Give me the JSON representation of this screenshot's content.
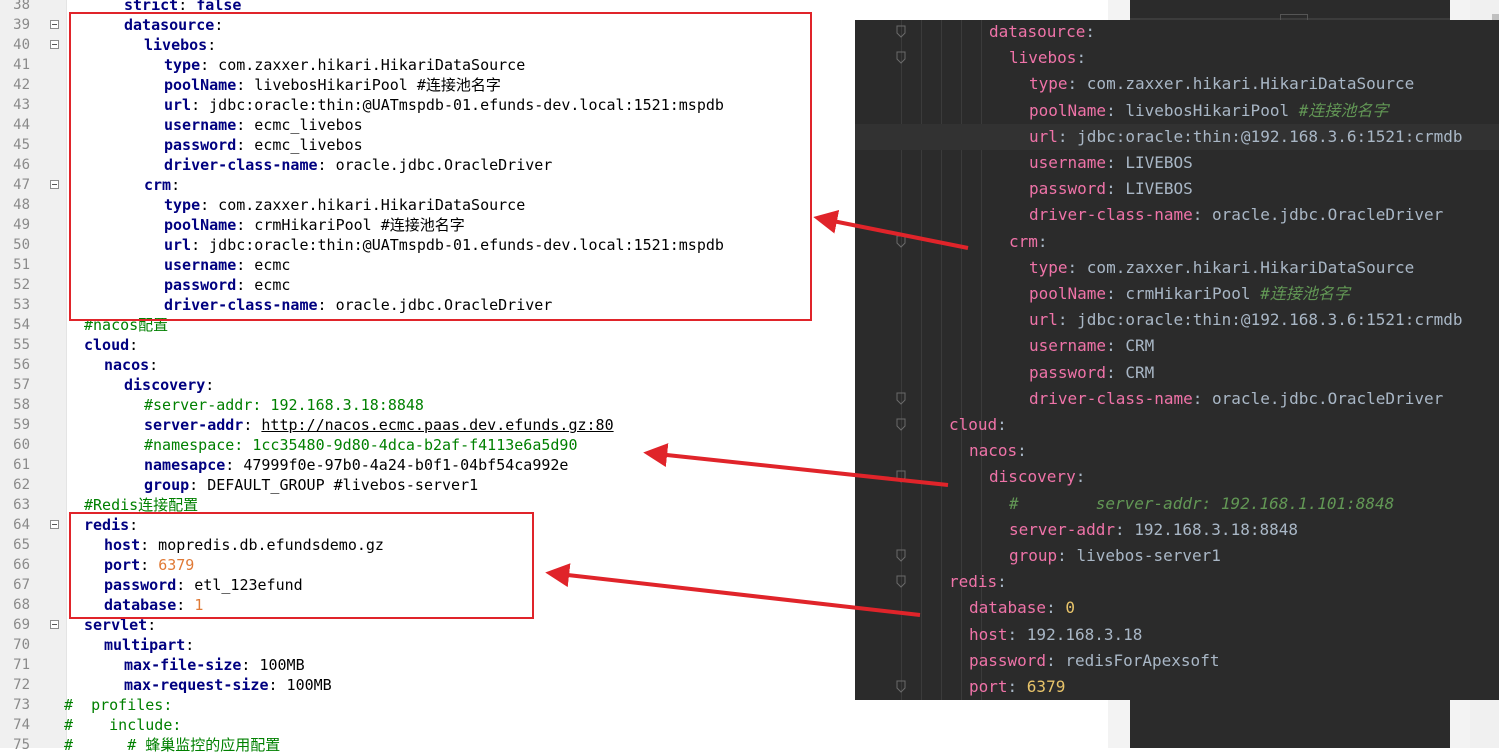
{
  "left_editor": {
    "lines": [
      {
        "num": "38",
        "fold": false,
        "indent": 6,
        "parts": [
          {
            "t": "strict",
            "c": "k"
          },
          {
            "t": ": ",
            "c": "v"
          },
          {
            "t": "false",
            "c": "k"
          }
        ]
      },
      {
        "num": "39",
        "fold": true,
        "indent": 6,
        "parts": [
          {
            "t": "datasource",
            "c": "k"
          },
          {
            "t": ":",
            "c": "v"
          }
        ]
      },
      {
        "num": "40",
        "fold": true,
        "indent": 8,
        "parts": [
          {
            "t": "livebos",
            "c": "k"
          },
          {
            "t": ":",
            "c": "v"
          }
        ]
      },
      {
        "num": "41",
        "fold": false,
        "indent": 10,
        "parts": [
          {
            "t": "type",
            "c": "k"
          },
          {
            "t": ": com.zaxxer.hikari.HikariDataSource",
            "c": "v"
          }
        ]
      },
      {
        "num": "42",
        "fold": false,
        "indent": 10,
        "parts": [
          {
            "t": "poolName",
            "c": "k"
          },
          {
            "t": ": livebosHikariPool #连接池名字",
            "c": "v"
          }
        ]
      },
      {
        "num": "43",
        "fold": false,
        "indent": 10,
        "parts": [
          {
            "t": "url",
            "c": "k"
          },
          {
            "t": ": jdbc:oracle:thin:@UATmspdb-01.efunds-dev.local:1521:mspdb",
            "c": "v"
          }
        ]
      },
      {
        "num": "44",
        "fold": false,
        "indent": 10,
        "parts": [
          {
            "t": "username",
            "c": "k"
          },
          {
            "t": ": ecmc_livebos",
            "c": "v"
          }
        ]
      },
      {
        "num": "45",
        "fold": false,
        "indent": 10,
        "parts": [
          {
            "t": "password",
            "c": "k"
          },
          {
            "t": ": ecmc_livebos",
            "c": "v"
          }
        ]
      },
      {
        "num": "46",
        "fold": false,
        "indent": 10,
        "parts": [
          {
            "t": "driver-class-name",
            "c": "k"
          },
          {
            "t": ": oracle.jdbc.OracleDriver",
            "c": "v"
          }
        ]
      },
      {
        "num": "47",
        "fold": true,
        "indent": 8,
        "parts": [
          {
            "t": "crm",
            "c": "k"
          },
          {
            "t": ":",
            "c": "v"
          }
        ]
      },
      {
        "num": "48",
        "fold": false,
        "indent": 10,
        "parts": [
          {
            "t": "type",
            "c": "k"
          },
          {
            "t": ": com.zaxxer.hikari.HikariDataSource",
            "c": "v"
          }
        ]
      },
      {
        "num": "49",
        "fold": false,
        "indent": 10,
        "parts": [
          {
            "t": "poolName",
            "c": "k"
          },
          {
            "t": ": crmHikariPool #连接池名字",
            "c": "v"
          }
        ]
      },
      {
        "num": "50",
        "fold": false,
        "indent": 10,
        "parts": [
          {
            "t": "url",
            "c": "k"
          },
          {
            "t": ": jdbc:oracle:thin:@UATmspdb-01.efunds-dev.local:1521:mspdb",
            "c": "v"
          }
        ]
      },
      {
        "num": "51",
        "fold": false,
        "indent": 10,
        "parts": [
          {
            "t": "username",
            "c": "k"
          },
          {
            "t": ": ecmc",
            "c": "v"
          }
        ]
      },
      {
        "num": "52",
        "fold": false,
        "indent": 10,
        "parts": [
          {
            "t": "password",
            "c": "k"
          },
          {
            "t": ": ecmc",
            "c": "v"
          }
        ]
      },
      {
        "num": "53",
        "fold": false,
        "indent": 10,
        "parts": [
          {
            "t": "driver-class-name",
            "c": "k"
          },
          {
            "t": ": oracle.jdbc.OracleDriver",
            "c": "v"
          }
        ]
      },
      {
        "num": "54",
        "fold": false,
        "indent": 2,
        "parts": [
          {
            "t": "#nacos配置",
            "c": "c"
          }
        ]
      },
      {
        "num": "55",
        "fold": false,
        "indent": 2,
        "parts": [
          {
            "t": "cloud",
            "c": "k"
          },
          {
            "t": ":",
            "c": "v"
          }
        ]
      },
      {
        "num": "56",
        "fold": false,
        "indent": 4,
        "parts": [
          {
            "t": "nacos",
            "c": "k"
          },
          {
            "t": ":",
            "c": "v"
          }
        ]
      },
      {
        "num": "57",
        "fold": false,
        "indent": 6,
        "parts": [
          {
            "t": "discovery",
            "c": "k"
          },
          {
            "t": ":",
            "c": "v"
          }
        ]
      },
      {
        "num": "58",
        "fold": false,
        "indent": 8,
        "parts": [
          {
            "t": "#server-addr: 192.168.3.18:8848",
            "c": "c"
          }
        ]
      },
      {
        "num": "59",
        "fold": false,
        "indent": 8,
        "parts": [
          {
            "t": "server-addr",
            "c": "k"
          },
          {
            "t": ": ",
            "c": "v"
          },
          {
            "t": "http://nacos.ecmc.paas.dev.efunds.gz:80",
            "c": "u"
          }
        ]
      },
      {
        "num": "60",
        "fold": false,
        "indent": 8,
        "parts": [
          {
            "t": "#namespace: 1cc35480-9d80-4dca-b2af-f4113e6a5d90",
            "c": "c"
          }
        ]
      },
      {
        "num": "61",
        "fold": false,
        "indent": 8,
        "parts": [
          {
            "t": "namesapce",
            "c": "k"
          },
          {
            "t": ": 47999f0e-97b0-4a24-b0f1-04bf54ca992e",
            "c": "v"
          }
        ]
      },
      {
        "num": "62",
        "fold": false,
        "indent": 8,
        "parts": [
          {
            "t": "group",
            "c": "k"
          },
          {
            "t": ": DEFAULT_GROUP #livebos-server1",
            "c": "v"
          }
        ]
      },
      {
        "num": "63",
        "fold": false,
        "indent": 2,
        "parts": [
          {
            "t": "#Redis连接配置",
            "c": "c"
          }
        ]
      },
      {
        "num": "64",
        "fold": true,
        "indent": 2,
        "parts": [
          {
            "t": "redis",
            "c": "k"
          },
          {
            "t": ":",
            "c": "v"
          }
        ]
      },
      {
        "num": "65",
        "fold": false,
        "indent": 4,
        "parts": [
          {
            "t": "host",
            "c": "k"
          },
          {
            "t": ": mopredis.db.efundsdemo.gz",
            "c": "v"
          }
        ]
      },
      {
        "num": "66",
        "fold": false,
        "indent": 4,
        "parts": [
          {
            "t": "port",
            "c": "k"
          },
          {
            "t": ": ",
            "c": "v"
          },
          {
            "t": "6379",
            "c": "n"
          }
        ]
      },
      {
        "num": "67",
        "fold": false,
        "indent": 4,
        "parts": [
          {
            "t": "password",
            "c": "k"
          },
          {
            "t": ": etl_123efund",
            "c": "v"
          }
        ]
      },
      {
        "num": "68",
        "fold": false,
        "indent": 4,
        "parts": [
          {
            "t": "database",
            "c": "k"
          },
          {
            "t": ": ",
            "c": "v"
          },
          {
            "t": "1",
            "c": "n"
          }
        ]
      },
      {
        "num": "69",
        "fold": true,
        "indent": 2,
        "parts": [
          {
            "t": "servlet",
            "c": "k"
          },
          {
            "t": ":",
            "c": "v"
          }
        ]
      },
      {
        "num": "70",
        "fold": false,
        "indent": 4,
        "parts": [
          {
            "t": "multipart",
            "c": "k"
          },
          {
            "t": ":",
            "c": "v"
          }
        ]
      },
      {
        "num": "71",
        "fold": false,
        "indent": 6,
        "parts": [
          {
            "t": "max-file-size",
            "c": "k"
          },
          {
            "t": ": 100MB",
            "c": "v"
          }
        ]
      },
      {
        "num": "72",
        "fold": false,
        "indent": 6,
        "parts": [
          {
            "t": "max-request-size",
            "c": "k"
          },
          {
            "t": ": 100MB",
            "c": "v"
          }
        ]
      },
      {
        "num": "73",
        "fold": false,
        "indent": 0,
        "parts": [
          {
            "t": "#  profiles:",
            "c": "c"
          }
        ]
      },
      {
        "num": "74",
        "fold": false,
        "indent": 0,
        "parts": [
          {
            "t": "#    include:",
            "c": "c"
          }
        ]
      },
      {
        "num": "75",
        "fold": false,
        "indent": 0,
        "parts": [
          {
            "t": "#      # 蜂巢监控的应用配置",
            "c": "c"
          }
        ]
      }
    ]
  },
  "right_editor": {
    "lines": [
      {
        "indent": 5,
        "parts": [
          {
            "t": "datasource",
            "c": "dk"
          },
          {
            "t": ":",
            "c": "dv"
          }
        ]
      },
      {
        "indent": 6,
        "parts": [
          {
            "t": "livebos",
            "c": "dk"
          },
          {
            "t": ":",
            "c": "dv"
          }
        ]
      },
      {
        "indent": 7,
        "parts": [
          {
            "t": "type",
            "c": "dk"
          },
          {
            "t": ": com.zaxxer.hikari.HikariDataSource",
            "c": "dv"
          }
        ]
      },
      {
        "indent": 7,
        "parts": [
          {
            "t": "poolName",
            "c": "dk"
          },
          {
            "t": ": livebosHikariPool ",
            "c": "dv"
          },
          {
            "t": "#连接池名字",
            "c": "dc"
          }
        ]
      },
      {
        "indent": 7,
        "parts": [
          {
            "t": "url",
            "c": "dk"
          },
          {
            "t": ": jdbc:oracle:thin:@192.168.3.6:1521:crmdb",
            "c": "dv"
          }
        ]
      },
      {
        "indent": 7,
        "parts": [
          {
            "t": "username",
            "c": "dk"
          },
          {
            "t": ": LIVEBOS",
            "c": "dv"
          }
        ]
      },
      {
        "indent": 7,
        "parts": [
          {
            "t": "password",
            "c": "dk"
          },
          {
            "t": ": LIVEBOS",
            "c": "dv"
          }
        ]
      },
      {
        "indent": 7,
        "parts": [
          {
            "t": "driver-class-name",
            "c": "dk"
          },
          {
            "t": ": oracle.jdbc.OracleDriver",
            "c": "dv"
          }
        ]
      },
      {
        "indent": 6,
        "parts": [
          {
            "t": "crm",
            "c": "dk"
          },
          {
            "t": ":",
            "c": "dv"
          }
        ]
      },
      {
        "indent": 7,
        "parts": [
          {
            "t": "type",
            "c": "dk"
          },
          {
            "t": ": com.zaxxer.hikari.HikariDataSource",
            "c": "dv"
          }
        ]
      },
      {
        "indent": 7,
        "parts": [
          {
            "t": "poolName",
            "c": "dk"
          },
          {
            "t": ": crmHikariPool ",
            "c": "dv"
          },
          {
            "t": "#连接池名字",
            "c": "dc"
          }
        ]
      },
      {
        "indent": 7,
        "parts": [
          {
            "t": "url",
            "c": "dk"
          },
          {
            "t": ": jdbc:oracle:thin:@192.168.3.6:1521:crmdb",
            "c": "dv"
          }
        ]
      },
      {
        "indent": 7,
        "parts": [
          {
            "t": "username",
            "c": "dk"
          },
          {
            "t": ": CRM",
            "c": "dv"
          }
        ]
      },
      {
        "indent": 7,
        "parts": [
          {
            "t": "password",
            "c": "dk"
          },
          {
            "t": ": CRM",
            "c": "dv"
          }
        ]
      },
      {
        "indent": 7,
        "parts": [
          {
            "t": "driver-class-name",
            "c": "dk"
          },
          {
            "t": ": oracle.jdbc.OracleDriver",
            "c": "dv"
          }
        ]
      },
      {
        "indent": 3,
        "parts": [
          {
            "t": "cloud",
            "c": "dk"
          },
          {
            "t": ":",
            "c": "dv"
          }
        ]
      },
      {
        "indent": 4,
        "parts": [
          {
            "t": "nacos",
            "c": "dk"
          },
          {
            "t": ":",
            "c": "dv"
          }
        ]
      },
      {
        "indent": 5,
        "parts": [
          {
            "t": "discovery",
            "c": "dk"
          },
          {
            "t": ":",
            "c": "dv"
          }
        ]
      },
      {
        "indent": 6,
        "parts": [
          {
            "t": "#        server-addr: 192.168.1.101:8848",
            "c": "dc"
          }
        ]
      },
      {
        "indent": 6,
        "parts": [
          {
            "t": "server-addr",
            "c": "dk"
          },
          {
            "t": ": 192.168.3.18:8848",
            "c": "dv"
          }
        ]
      },
      {
        "indent": 6,
        "parts": [
          {
            "t": "group",
            "c": "dk"
          },
          {
            "t": ": livebos-server1",
            "c": "dv"
          }
        ]
      },
      {
        "indent": 3,
        "parts": [
          {
            "t": "redis",
            "c": "dk"
          },
          {
            "t": ":",
            "c": "dv"
          }
        ]
      },
      {
        "indent": 4,
        "parts": [
          {
            "t": "database",
            "c": "dk"
          },
          {
            "t": ": ",
            "c": "dv"
          },
          {
            "t": "0",
            "c": "dn"
          }
        ]
      },
      {
        "indent": 4,
        "parts": [
          {
            "t": "host",
            "c": "dk"
          },
          {
            "t": ": 192.168.3.18",
            "c": "dv"
          }
        ]
      },
      {
        "indent": 4,
        "parts": [
          {
            "t": "password",
            "c": "dk"
          },
          {
            "t": ": redisForApexsoft",
            "c": "dv"
          }
        ]
      },
      {
        "indent": 4,
        "parts": [
          {
            "t": "port",
            "c": "dk"
          },
          {
            "t": ": ",
            "c": "dv"
          },
          {
            "t": "6379",
            "c": "dn"
          }
        ]
      }
    ]
  },
  "colors": {
    "highlight_box": "#e0242a",
    "arrow": "#e0242a",
    "dark_bg": "#2b2b2b",
    "dark_key": "#ef73a8",
    "left_key": "#000080",
    "left_comment": "#008000"
  }
}
